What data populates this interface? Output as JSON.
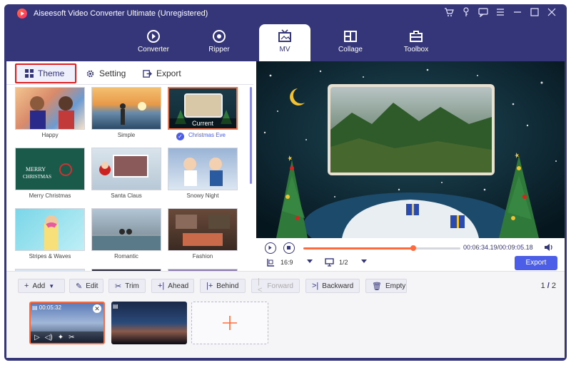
{
  "window": {
    "title": "Aiseesoft Video Converter Ultimate (Unregistered)"
  },
  "title_icons": [
    "cart-icon",
    "key-icon",
    "chat-icon",
    "menu-icon",
    "minimize-icon",
    "maximize-icon",
    "close-icon"
  ],
  "nav": {
    "tabs": [
      {
        "label": "Converter",
        "icon": "converter-icon"
      },
      {
        "label": "Ripper",
        "icon": "ripper-icon"
      },
      {
        "label": "MV",
        "icon": "mv-icon",
        "active": true
      },
      {
        "label": "Collage",
        "icon": "collage-icon"
      },
      {
        "label": "Toolbox",
        "icon": "toolbox-icon"
      }
    ]
  },
  "subtabs": [
    {
      "label": "Theme",
      "icon": "grid-icon",
      "active": true
    },
    {
      "label": "Setting",
      "icon": "gear-icon"
    },
    {
      "label": "Export",
      "icon": "export-icon"
    }
  ],
  "themes": [
    {
      "label": "Happy"
    },
    {
      "label": "Simple"
    },
    {
      "label": "Christmas Eve",
      "current": true,
      "overlay": "Current"
    },
    {
      "label": "Merry Christmas",
      "overlay": "MERRY CHRISTMAS"
    },
    {
      "label": "Santa Claus"
    },
    {
      "label": "Snowy Night"
    },
    {
      "label": "Stripes & Waves"
    },
    {
      "label": "Romantic"
    },
    {
      "label": "Fashion"
    }
  ],
  "player": {
    "time": "00:06:34.19/00:09:05.18",
    "progress": 0.7,
    "aspect": "16:9",
    "page": "1/2",
    "export_label": "Export"
  },
  "toolbar": {
    "add": "Add",
    "edit": "Edit",
    "trim": "Trim",
    "ahead": "Ahead",
    "behind": "Behind",
    "forward": "Forward",
    "backward": "Backward",
    "empty": "Empty",
    "page_current": "1",
    "page_total": "2"
  },
  "clips": [
    {
      "duration": "00:05:32",
      "selected": true
    },
    {
      "duration": ""
    }
  ],
  "colors": {
    "frame": "#35357a",
    "accent": "#ff6a3d",
    "primary": "#4c5ee8"
  }
}
